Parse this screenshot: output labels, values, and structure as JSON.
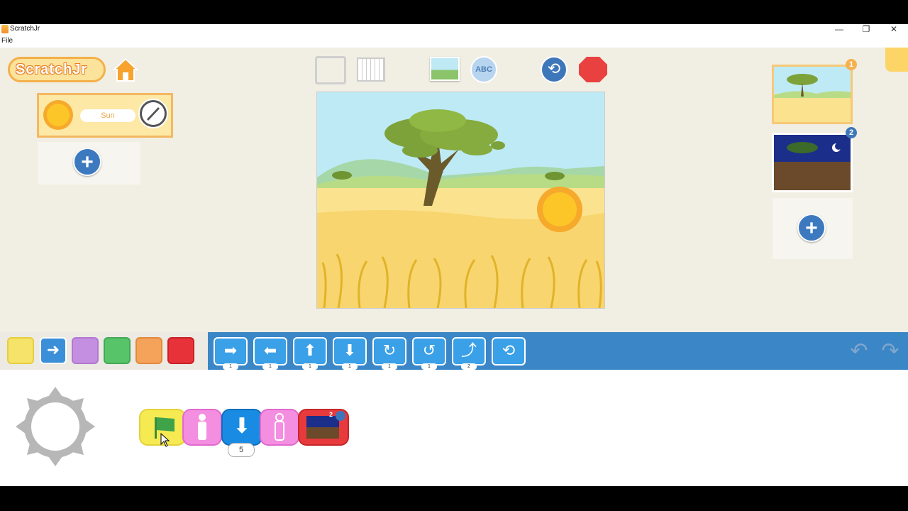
{
  "window": {
    "title": "ScratchJr",
    "minimize_glyph": "—",
    "maximize_glyph": "❐",
    "close_glyph": "✕"
  },
  "menu": {
    "file": "File"
  },
  "app": {
    "logo_text": "ScratchJr",
    "home_icon": "home-icon"
  },
  "sprites": {
    "items": [
      {
        "name": "Sun",
        "icon": "sun-icon"
      }
    ],
    "add_glyph": "+"
  },
  "toolbar": {
    "fullscreen_icon": "fullscreen-icon",
    "grid_icon": "grid-icon",
    "background_icon": "background-icon",
    "text_icon_label": "ABC",
    "reset_icon": "reset-icon",
    "stop_icon": "stop-icon"
  },
  "pages": {
    "items": [
      {
        "number": "1",
        "theme": "savanna-day"
      },
      {
        "number": "2",
        "theme": "savanna-night"
      }
    ],
    "add_glyph": "+"
  },
  "categories": [
    {
      "name": "triggering",
      "color": "#f6e46a"
    },
    {
      "name": "motion",
      "color": "#3b8fd9"
    },
    {
      "name": "looks",
      "color": "#c48fe0"
    },
    {
      "name": "sound",
      "color": "#57c46a"
    },
    {
      "name": "control",
      "color": "#f5a35a"
    },
    {
      "name": "end",
      "color": "#e8323a"
    }
  ],
  "palette": {
    "blocks": [
      {
        "name": "move-right",
        "glyph": "➡",
        "count": "1"
      },
      {
        "name": "move-left",
        "glyph": "⬅",
        "count": "1"
      },
      {
        "name": "move-up",
        "glyph": "⬆",
        "count": "1"
      },
      {
        "name": "move-down",
        "glyph": "⬇",
        "count": "1"
      },
      {
        "name": "turn-right",
        "glyph": "↻",
        "count": "1"
      },
      {
        "name": "turn-left",
        "glyph": "↺",
        "count": "1"
      },
      {
        "name": "hop",
        "glyph": "⤴",
        "count": "2"
      },
      {
        "name": "go-home",
        "glyph": "⟲",
        "count": ""
      }
    ],
    "undo_glyph": "↶",
    "redo_glyph": "↷"
  },
  "script": {
    "blocks": [
      "green-flag",
      "show",
      "move-down",
      "hide",
      "go-to-page"
    ],
    "move_down_value": "5",
    "page_target": "2"
  },
  "colors": {
    "palette_bar": "#3b86c6",
    "stage_bg": "#f1eee4",
    "accent_orange": "#f4b04a"
  }
}
